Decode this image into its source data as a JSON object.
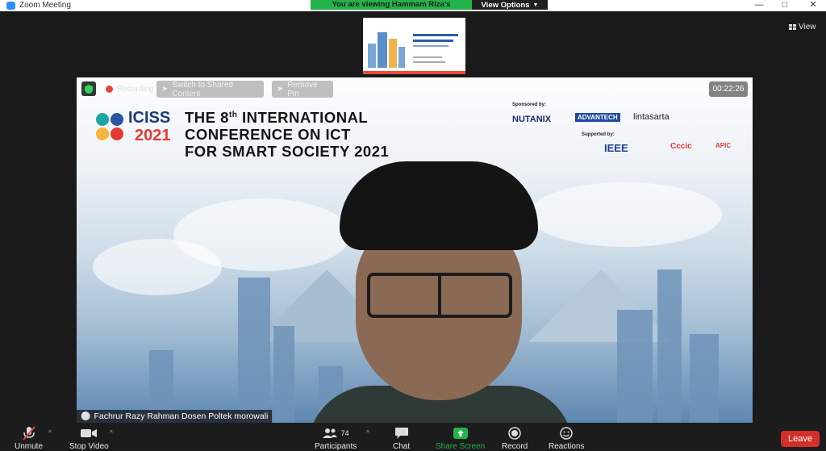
{
  "window": {
    "title": "Zoom Meeting"
  },
  "share_bar": {
    "viewing_text": "You are viewing Hammam Riza's screen",
    "view_options_label": "View Options"
  },
  "view_button": {
    "label": "View"
  },
  "video": {
    "recording_label": "Recording",
    "switch_label": "Switch to Shared Content",
    "remove_pin_label": "Remove Pin",
    "timer": "00:22:26",
    "participant_name": "Fachrur Razy Rahman Dosen Poltek morowali"
  },
  "banner": {
    "logo_text": "ICISS",
    "logo_year": "2021",
    "title_line1_prefix": "THE 8",
    "title_line1_sup": "th",
    "title_line1_suffix": " INTERNATIONAL",
    "title_line2": "CONFERENCE ON ICT",
    "title_line3": "FOR SMART SOCIETY 2021",
    "sponsored_by": "Sponsored by:",
    "supported_by": "Supported by:",
    "sponsors": [
      "NUTANIX",
      "ADVANTECH",
      "lintasarta"
    ],
    "supporters": [
      "IEEE",
      "Cccic",
      "APIC"
    ]
  },
  "thumbnail": {
    "heading": "Collaboration in Artificial Intelligence Research and Industrial Innovation"
  },
  "toolbar": {
    "unmute": "Unmute",
    "stop_video": "Stop Video",
    "participants": "Participants",
    "participants_count": "74",
    "chat": "Chat",
    "share_screen": "Share Screen",
    "record": "Record",
    "reactions": "Reactions",
    "leave": "Leave"
  },
  "colors": {
    "share_green": "#24b24a",
    "leave_red": "#d4302a",
    "zoom_blue": "#2d8cff"
  }
}
